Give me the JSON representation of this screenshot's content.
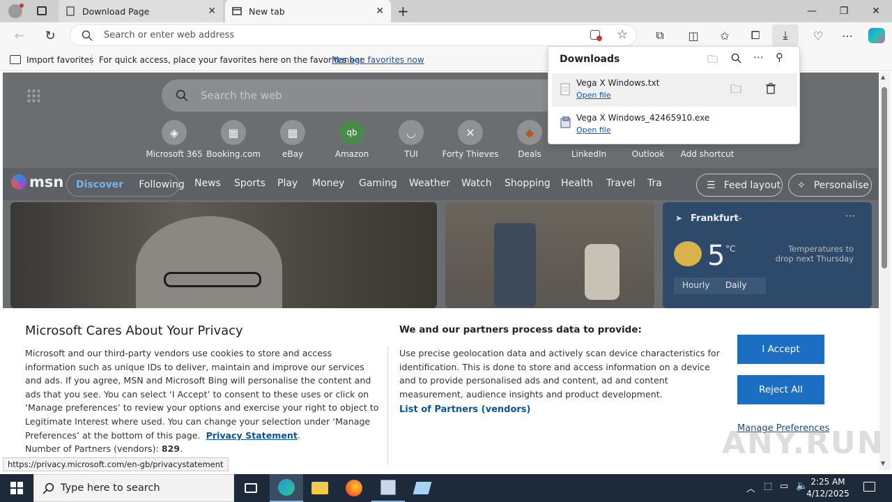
{
  "browser": {
    "tabs": [
      {
        "title": "Download Page"
      },
      {
        "title": "New tab"
      }
    ],
    "address_placeholder": "Search or enter web address"
  },
  "favorites_bar": {
    "import_label": "Import favorites",
    "hint": "For quick access, place your favorites here on the favorites bar.",
    "manage_link": "Manage favorites now"
  },
  "downloads": {
    "title": "Downloads",
    "items": [
      {
        "name": "Vega X Windows.txt",
        "action": "Open file"
      },
      {
        "name": "Vega X Windows_42465910.exe",
        "action": "Open file"
      }
    ]
  },
  "newtab": {
    "search_placeholder": "Search the web",
    "shortcuts": [
      "Microsoft 365",
      "Booking.com",
      "eBay",
      "Amazon",
      "TUI",
      "Forty Thieves",
      "Deals",
      "LinkedIn",
      "Outlook",
      "Add shortcut"
    ],
    "msn": {
      "logo": "msn",
      "tabs": [
        "Discover",
        "Following"
      ],
      "nav": [
        "News",
        "Sports",
        "Play",
        "Money",
        "Gaming",
        "Weather",
        "Watch",
        "Shopping",
        "Health",
        "Travel",
        "Tra"
      ],
      "feed_layout": "Feed layout",
      "personalise": "Personalise"
    },
    "weather": {
      "city": "Frankfurt",
      "temp": "5",
      "unit": "°C",
      "note": "Temperatures to drop next Thursday",
      "tabs": [
        "Hourly",
        "Daily"
      ]
    }
  },
  "privacy": {
    "title": "Microsoft Cares About Your Privacy",
    "body": "Microsoft and our third-party vendors use cookies to store and access information such as unique IDs to deliver, maintain and improve our services and ads. If you agree, MSN and Microsoft Bing will personalise the content and ads that you see. You can select ‘I Accept’ to consent to these uses or click on ‘Manage preferences’ to review your options and exercise your right to object to Legitimate Interest where used.  You can change your selection under ‘Manage Preferences’ at the bottom of this page.",
    "privacy_link": "Privacy Statement",
    "partners_label": "Number of Partners (vendors):",
    "partners_count": "829",
    "right_title": "We and our partners process data to provide:",
    "right_body": "Use precise geolocation data and actively scan device characteristics for identification. This is done to store and access information on a device and to provide personalised ads and content, ad and content measurement, audience insights and product development.",
    "list_link": "List of Partners (vendors)",
    "accept": "I Accept",
    "reject": "Reject All",
    "manage": "Manage Preferences"
  },
  "status_url": "https://privacy.microsoft.com/en-gb/privacystatement",
  "watermark": "ANY.RUN",
  "taskbar": {
    "search_placeholder": "Type here to search",
    "time": "2:25 AM",
    "date": "4/12/2025"
  },
  "colors": {
    "accent": "#1b6ec2",
    "link": "#0b55c4",
    "taskbar": "#1c2a3a"
  }
}
